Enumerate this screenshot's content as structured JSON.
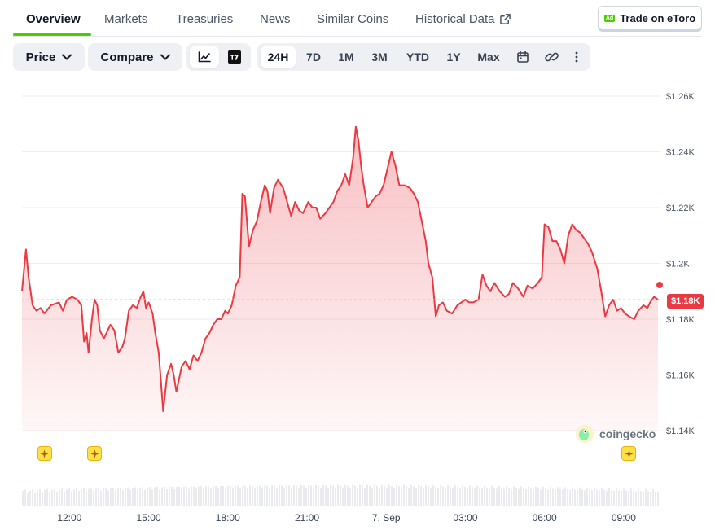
{
  "tabs": [
    {
      "label": "Overview",
      "active": true
    },
    {
      "label": "Markets"
    },
    {
      "label": "Treasuries"
    },
    {
      "label": "News"
    },
    {
      "label": "Similar Coins"
    },
    {
      "label": "Historical Data",
      "external": true
    }
  ],
  "trade_button": {
    "label": "Trade on eToro",
    "badge": "Ad"
  },
  "toolbar": {
    "price_label": "Price",
    "compare_label": "Compare",
    "chart_types": [
      "line-chart-icon",
      "tradingview-icon"
    ],
    "ranges": [
      "24H",
      "7D",
      "1M",
      "3M",
      "YTD",
      "1Y",
      "Max"
    ],
    "active_range": "24H",
    "tools": [
      "calendar-icon",
      "link-icon",
      "more-icon"
    ]
  },
  "chart_data": {
    "type": "area",
    "yticks": [
      "$1.26K",
      "$1.24K",
      "$1.22K",
      "$1.2K",
      "$1.18K",
      "$1.16K",
      "$1.14K"
    ],
    "ytick_values": [
      1260,
      1240,
      1220,
      1200,
      1180,
      1160,
      1140
    ],
    "ylim": [
      1140,
      1260
    ],
    "xticks": [
      "12:00",
      "15:00",
      "18:00",
      "21:00",
      "7. Sep",
      "03:00",
      "06:00",
      "09:00"
    ],
    "xtick_hours": [
      12,
      15,
      18,
      21,
      24,
      27,
      30,
      33
    ],
    "xlim_hours": [
      10.2,
      34.3
    ],
    "current_price": 1187,
    "current_label": "$1.18K",
    "grid": true,
    "line_color": "#ea3943",
    "series": [
      {
        "values": [
          [
            10.2,
            1190
          ],
          [
            10.35,
            1205
          ],
          [
            10.45,
            1195
          ],
          [
            10.6,
            1185
          ],
          [
            10.75,
            1183
          ],
          [
            10.9,
            1184
          ],
          [
            11.05,
            1182
          ],
          [
            11.3,
            1185
          ],
          [
            11.6,
            1186
          ],
          [
            11.75,
            1183
          ],
          [
            11.9,
            1187
          ],
          [
            12.1,
            1188
          ],
          [
            12.3,
            1187
          ],
          [
            12.45,
            1185
          ],
          [
            12.55,
            1172
          ],
          [
            12.65,
            1175
          ],
          [
            12.72,
            1168
          ],
          [
            12.85,
            1180
          ],
          [
            12.95,
            1187
          ],
          [
            13.05,
            1185
          ],
          [
            13.15,
            1176
          ],
          [
            13.3,
            1173
          ],
          [
            13.45,
            1176
          ],
          [
            13.55,
            1178
          ],
          [
            13.7,
            1176
          ],
          [
            13.85,
            1168
          ],
          [
            14.0,
            1170
          ],
          [
            14.1,
            1173
          ],
          [
            14.25,
            1183
          ],
          [
            14.4,
            1185
          ],
          [
            14.55,
            1184
          ],
          [
            14.7,
            1188
          ],
          [
            14.8,
            1190
          ],
          [
            14.9,
            1184
          ],
          [
            15.0,
            1186
          ],
          [
            15.15,
            1182
          ],
          [
            15.25,
            1175
          ],
          [
            15.38,
            1168
          ],
          [
            15.55,
            1147
          ],
          [
            15.7,
            1160
          ],
          [
            15.85,
            1164
          ],
          [
            15.95,
            1160
          ],
          [
            16.05,
            1154
          ],
          [
            16.25,
            1163
          ],
          [
            16.4,
            1165
          ],
          [
            16.55,
            1162
          ],
          [
            16.7,
            1167
          ],
          [
            16.85,
            1165
          ],
          [
            17.0,
            1168
          ],
          [
            17.15,
            1173
          ],
          [
            17.3,
            1175
          ],
          [
            17.45,
            1178
          ],
          [
            17.6,
            1180
          ],
          [
            17.75,
            1180
          ],
          [
            17.9,
            1183
          ],
          [
            18.0,
            1182
          ],
          [
            18.15,
            1185
          ],
          [
            18.3,
            1192
          ],
          [
            18.45,
            1195
          ],
          [
            18.55,
            1225
          ],
          [
            18.65,
            1224
          ],
          [
            18.8,
            1206
          ],
          [
            18.95,
            1212
          ],
          [
            19.1,
            1215
          ],
          [
            19.25,
            1222
          ],
          [
            19.4,
            1228
          ],
          [
            19.5,
            1226
          ],
          [
            19.6,
            1218
          ],
          [
            19.75,
            1227
          ],
          [
            19.9,
            1230
          ],
          [
            20.1,
            1227
          ],
          [
            20.25,
            1222
          ],
          [
            20.4,
            1217
          ],
          [
            20.55,
            1222
          ],
          [
            20.7,
            1219
          ],
          [
            20.85,
            1218
          ],
          [
            21.05,
            1222
          ],
          [
            21.2,
            1220
          ],
          [
            21.35,
            1220
          ],
          [
            21.5,
            1216
          ],
          [
            21.7,
            1218
          ],
          [
            21.85,
            1220
          ],
          [
            22.0,
            1222
          ],
          [
            22.15,
            1226
          ],
          [
            22.3,
            1228
          ],
          [
            22.45,
            1232
          ],
          [
            22.6,
            1228
          ],
          [
            22.75,
            1238
          ],
          [
            22.85,
            1249
          ],
          [
            22.95,
            1244
          ],
          [
            23.05,
            1235
          ],
          [
            23.15,
            1228
          ],
          [
            23.3,
            1220
          ],
          [
            23.45,
            1222
          ],
          [
            23.6,
            1224
          ],
          [
            23.75,
            1225
          ],
          [
            23.9,
            1228
          ],
          [
            24.05,
            1234
          ],
          [
            24.2,
            1240
          ],
          [
            24.35,
            1235
          ],
          [
            24.5,
            1228
          ],
          [
            24.7,
            1228
          ],
          [
            24.9,
            1227
          ],
          [
            25.05,
            1225
          ],
          [
            25.2,
            1222
          ],
          [
            25.35,
            1215
          ],
          [
            25.5,
            1208
          ],
          [
            25.6,
            1200
          ],
          [
            25.75,
            1195
          ],
          [
            25.88,
            1181
          ],
          [
            26.0,
            1185
          ],
          [
            26.15,
            1186
          ],
          [
            26.3,
            1183
          ],
          [
            26.5,
            1182
          ],
          [
            26.7,
            1185
          ],
          [
            26.85,
            1186
          ],
          [
            27.0,
            1187
          ],
          [
            27.15,
            1186
          ],
          [
            27.3,
            1186
          ],
          [
            27.5,
            1187
          ],
          [
            27.65,
            1196
          ],
          [
            27.8,
            1192
          ],
          [
            27.95,
            1190
          ],
          [
            28.1,
            1193
          ],
          [
            28.3,
            1190
          ],
          [
            28.5,
            1188
          ],
          [
            28.65,
            1189
          ],
          [
            28.8,
            1193
          ],
          [
            29.0,
            1191
          ],
          [
            29.2,
            1188
          ],
          [
            29.35,
            1192
          ],
          [
            29.55,
            1191
          ],
          [
            29.75,
            1193
          ],
          [
            29.9,
            1195
          ],
          [
            30.0,
            1214
          ],
          [
            30.15,
            1213
          ],
          [
            30.3,
            1208
          ],
          [
            30.45,
            1208
          ],
          [
            30.6,
            1205
          ],
          [
            30.75,
            1200
          ],
          [
            30.9,
            1210
          ],
          [
            31.05,
            1214
          ],
          [
            31.2,
            1212
          ],
          [
            31.35,
            1211
          ],
          [
            31.5,
            1209
          ],
          [
            31.65,
            1207
          ],
          [
            31.8,
            1204
          ],
          [
            32.0,
            1198
          ],
          [
            32.15,
            1190
          ],
          [
            32.3,
            1181
          ],
          [
            32.45,
            1185
          ],
          [
            32.6,
            1187
          ],
          [
            32.75,
            1183
          ],
          [
            32.9,
            1184
          ],
          [
            33.05,
            1182
          ],
          [
            33.2,
            1181
          ],
          [
            33.4,
            1180
          ],
          [
            33.55,
            1183
          ],
          [
            33.75,
            1185
          ],
          [
            33.9,
            1184
          ],
          [
            34.0,
            1186
          ],
          [
            34.15,
            1188
          ],
          [
            34.3,
            1187
          ]
        ]
      }
    ]
  },
  "volume": {
    "note_hidden": ""
  },
  "watermark": {
    "text": "coingecko"
  },
  "events": [
    {
      "hour": 11.05,
      "icon": "sparkle-icon"
    },
    {
      "hour": 12.95,
      "icon": "sparkle-icon"
    },
    {
      "hour": 33.2,
      "icon": "sparkle-icon"
    }
  ],
  "colors": {
    "accent": "#4bcc00",
    "negative": "#ea3943"
  }
}
